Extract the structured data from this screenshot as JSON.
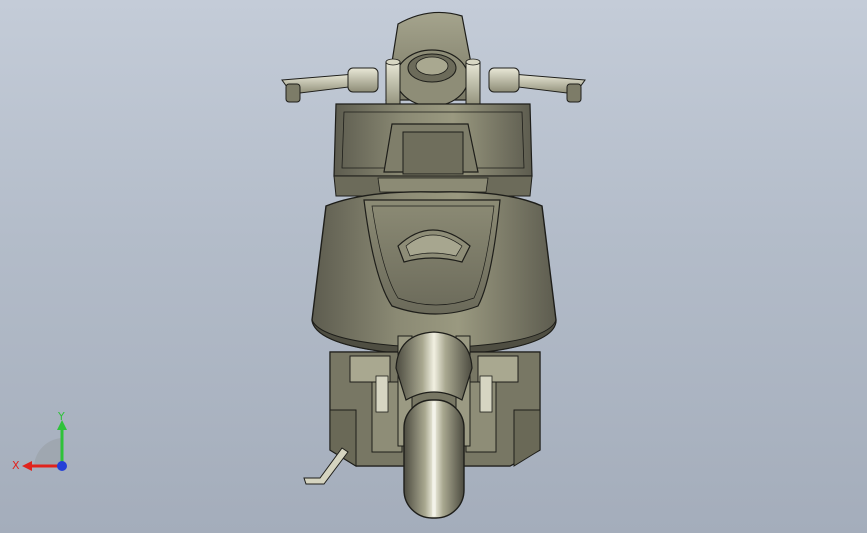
{
  "viewport": {
    "background_top": "#c4ccd8",
    "background_bottom": "#a4adbb",
    "model_color": "#7d7c68",
    "model_highlight": "#b9b8a1",
    "model_shadow": "#57564a",
    "edge_color": "#1e1e1a"
  },
  "triad": {
    "x_label": "X",
    "y_label": "Y",
    "x_color": "#e0231d",
    "y_color": "#2fc23a",
    "z_color": "#2440d8"
  }
}
